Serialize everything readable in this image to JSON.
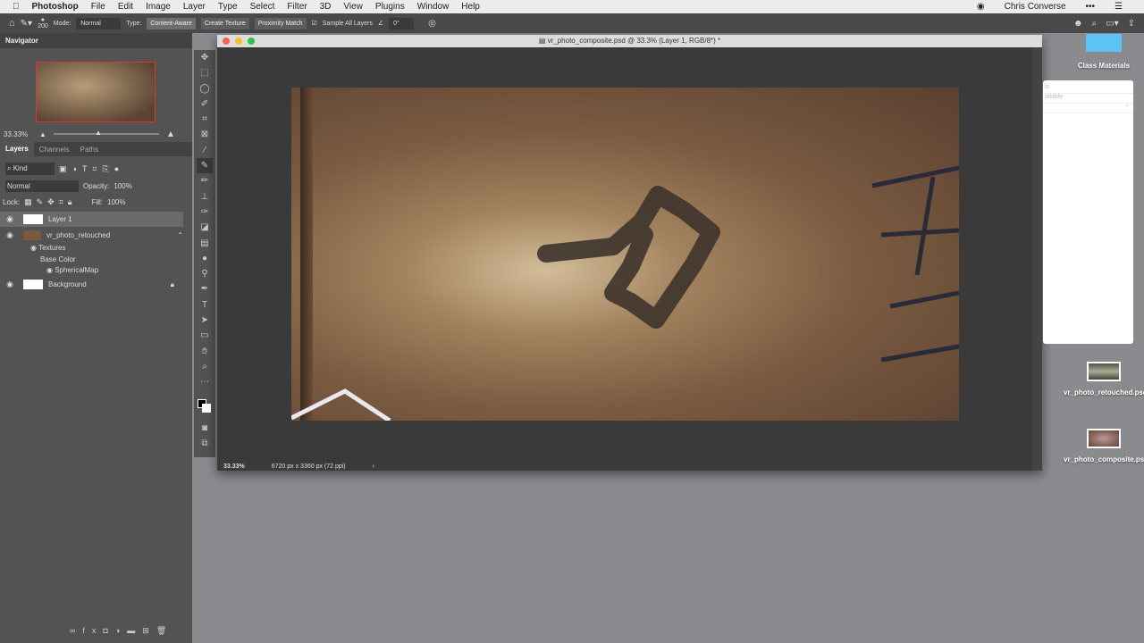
{
  "menubar": {
    "app": "Photoshop",
    "items": [
      "File",
      "Edit",
      "Image",
      "Layer",
      "Type",
      "Select",
      "Filter",
      "3D",
      "View",
      "Plugins",
      "Window",
      "Help"
    ],
    "user": "Chris Converse"
  },
  "options": {
    "brush_size": "200",
    "mode_label": "Mode:",
    "mode": "Normal",
    "type_label": "Type:",
    "types": [
      "Content-Aware",
      "Create Texture",
      "Proximity Match"
    ],
    "sample_all_layers": "Sample All Layers",
    "sample_all_checked": true,
    "angle": "0°"
  },
  "navigator": {
    "title": "Navigator",
    "zoom": "33.33%"
  },
  "layers": {
    "tabs": [
      "Layers",
      "Channels",
      "Paths"
    ],
    "filter": "Kind",
    "blend": "Normal",
    "opacity_label": "Opacity:",
    "opacity": "100%",
    "lock_label": "Lock:",
    "fill_label": "Fill:",
    "fill": "100%",
    "items": [
      {
        "name": "Layer 1"
      },
      {
        "name": "vr_photo_retouched"
      },
      {
        "name": "Textures"
      },
      {
        "name": "Base Color"
      },
      {
        "name": "SphericalMap"
      },
      {
        "name": "Background"
      }
    ]
  },
  "document": {
    "title": "vr_photo_composite.psd @ 33.3% (Layer 1, RGB/8*) *",
    "zoom": "33.33%",
    "size": "6720 px x 3360 px (72 ppi)"
  },
  "finder": {
    "folder": "Class Materials",
    "rows": [
      "ls",
      "ailable"
    ]
  },
  "desktop": {
    "files": [
      "vr_photo_retouched.psd",
      "vr_photo_composite.psd"
    ]
  }
}
